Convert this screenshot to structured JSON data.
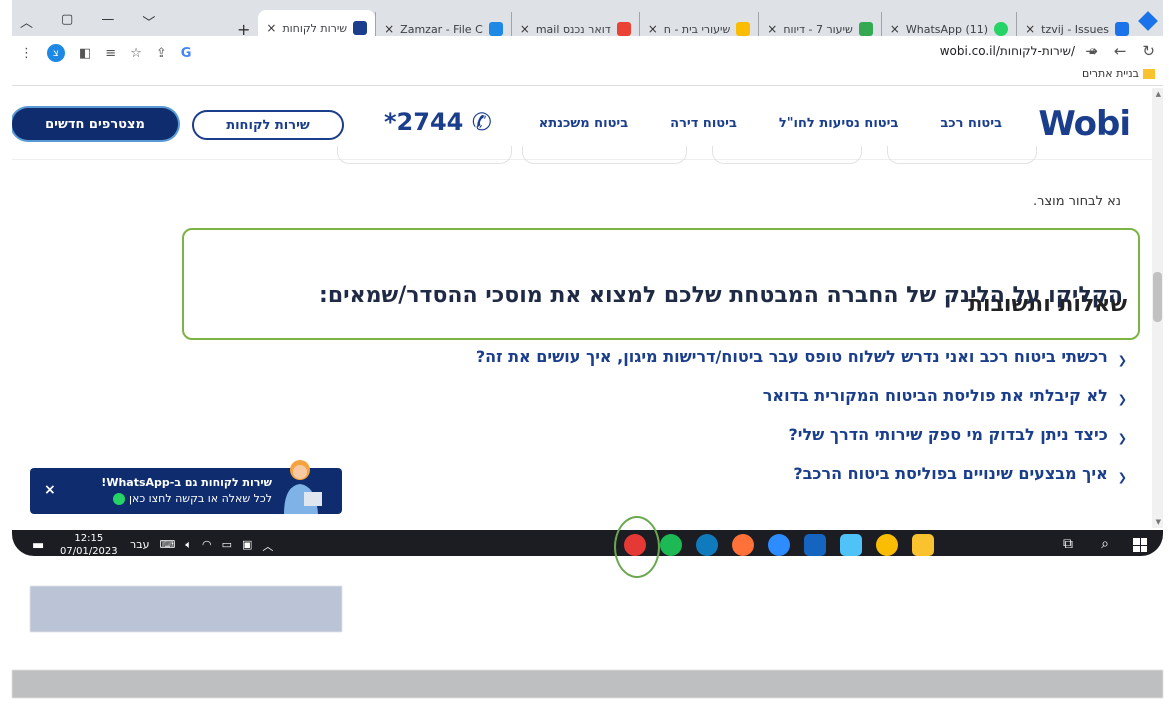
{
  "browser": {
    "tabs": [
      {
        "title": "tzvij - Issues",
        "color": "#1a73e8"
      },
      {
        "title": "(11) WhatsApp",
        "color": "#25d366"
      },
      {
        "title": "שיעור 7 - דיווח",
        "color": "#34a853"
      },
      {
        "title": "שיעורי בית - ח",
        "color": "#fbbc04"
      },
      {
        "title": "דואר נכנס mail",
        "color": "#ea4335"
      },
      {
        "title": "Zamzar - File C",
        "color": "#1e88e5"
      },
      {
        "title": "שירות לקוחות",
        "color": "#1a3e8c",
        "active": true
      }
    ],
    "new_tab": "+",
    "close": "×",
    "url": "wobi.co.il/שירות-לקוחות/",
    "profile_letter": "צ",
    "bookmark_folder": "בניית אתרים"
  },
  "site": {
    "logo": "Wobi",
    "nav": [
      "ביטוח רכב",
      "ביטוח נסיעות לחו\"ל",
      "ביטוח דירה",
      "ביטוח משכנתא"
    ],
    "phone": "*2744",
    "service_button": "שירות לקוחות",
    "join_button": "מצטרפים חדשים"
  },
  "content": {
    "choose_product": "נא לבחור מוצר.",
    "click_text": "הקליקו על הלינק של החברה המבטחת שלכם למצוא את מוסכי ההסדר/שמאים:",
    "qa_title": "שאלות ותשובות",
    "faq": [
      "רכשתי ביטוח רכב ואני נדרש לשלוח טופס עבר ביטוח/דרישות מיגון, איך עושים את זה?",
      "לא קיבלתי את פוליסת הביטוח המקורית בדואר",
      "כיצד ניתן לבדוק מי ספק שירותי הדרך שלי?",
      "איך מבצעים שינויים בפוליסת ביטוח הרכב?"
    ]
  },
  "whatsapp": {
    "title": "שירות לקוחות גם ב-WhatsApp!",
    "subtitle": "לכל שאלה או בקשה לחצו כאן",
    "close": "×"
  },
  "taskbar": {
    "time": "12:15",
    "date": "07/01/2023",
    "language": "עבר",
    "apps": [
      {
        "name": "chrome-alt",
        "color": "#e53935"
      },
      {
        "name": "spotify",
        "color": "#1db954"
      },
      {
        "name": "edge",
        "color": "#0f7bbd"
      },
      {
        "name": "firefox",
        "color": "#ff7139"
      },
      {
        "name": "zoom",
        "color": "#2d8cff"
      },
      {
        "name": "mail",
        "color": "#1565c0"
      },
      {
        "name": "store",
        "color": "#4fc3f7"
      },
      {
        "name": "chrome",
        "color": "#fbbc04"
      },
      {
        "name": "explorer",
        "color": "#f9c22e"
      }
    ]
  }
}
